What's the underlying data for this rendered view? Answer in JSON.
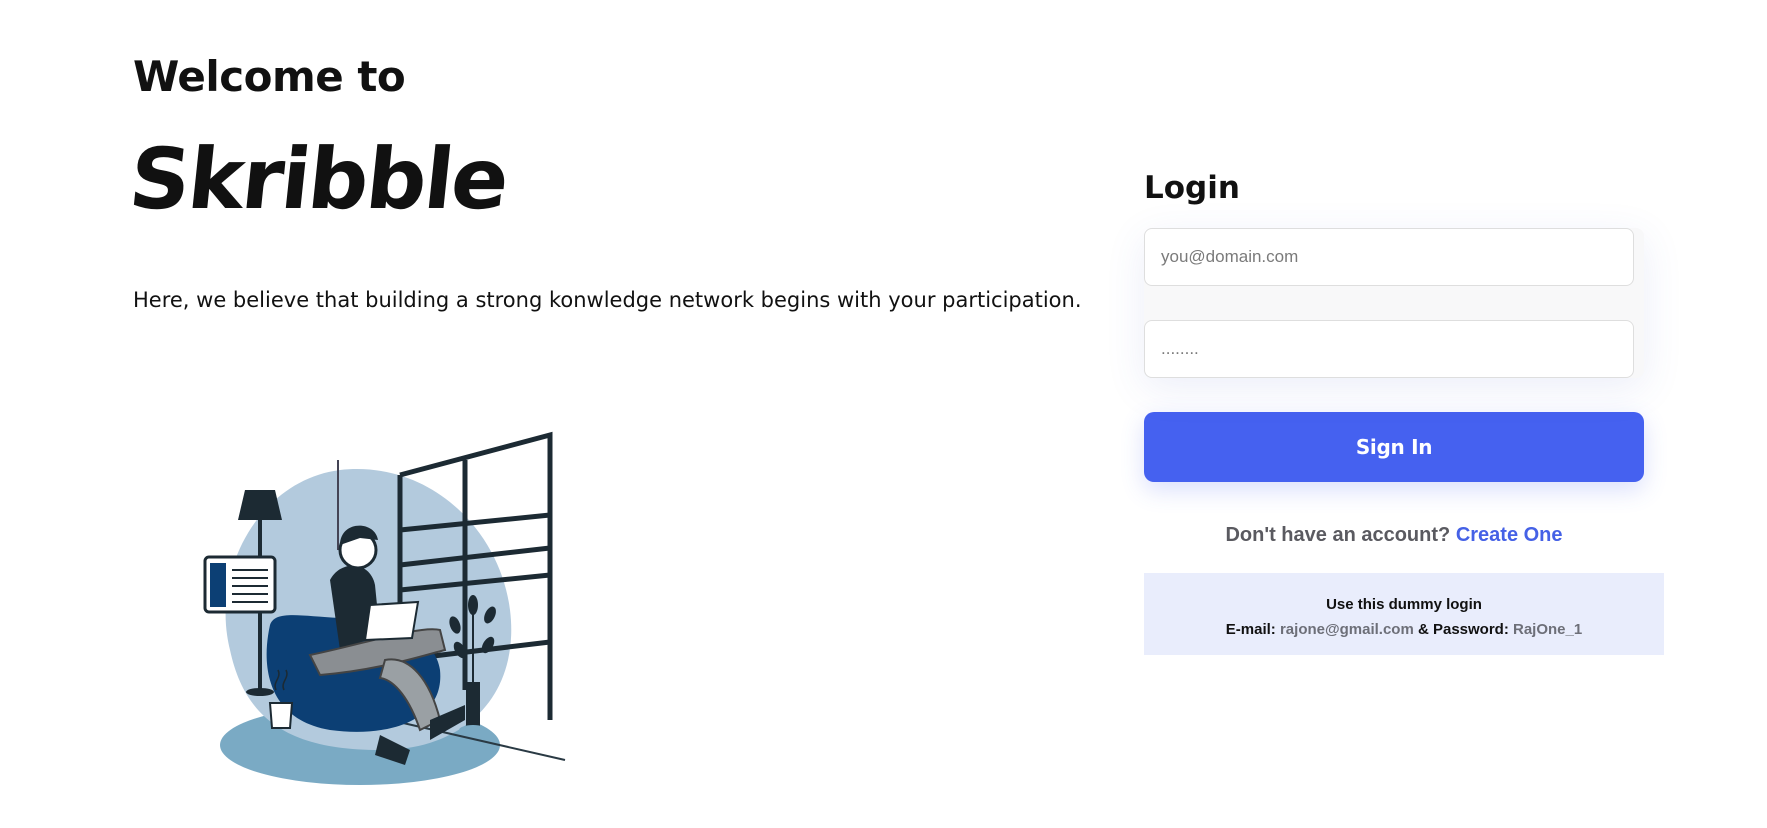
{
  "hero": {
    "welcome": "Welcome to",
    "brand": "Skribble",
    "tagline": "Here, we believe that building a strong konwledge network begins with your participation."
  },
  "login": {
    "title": "Login",
    "email_placeholder": "you@domain.com",
    "password_placeholder": "........",
    "signin_label": "Sign In",
    "no_account_text": "Don't have an account?",
    "create_link": "Create One"
  },
  "dummy": {
    "heading": "Use this dummy login",
    "email_label": "E-mail:",
    "email_value": "rajone@gmail.com",
    "joiner": "& Password:",
    "password_value": "RajOne_1"
  },
  "colors": {
    "accent": "#4561f0",
    "link": "#4561e6",
    "dummy_bg": "#e9edfc",
    "illustration_blue_light": "#b3cadd",
    "illustration_blue_dark": "#0c3f74"
  },
  "icons": {
    "illustration": "person-reading-on-beanbag-illustration"
  }
}
